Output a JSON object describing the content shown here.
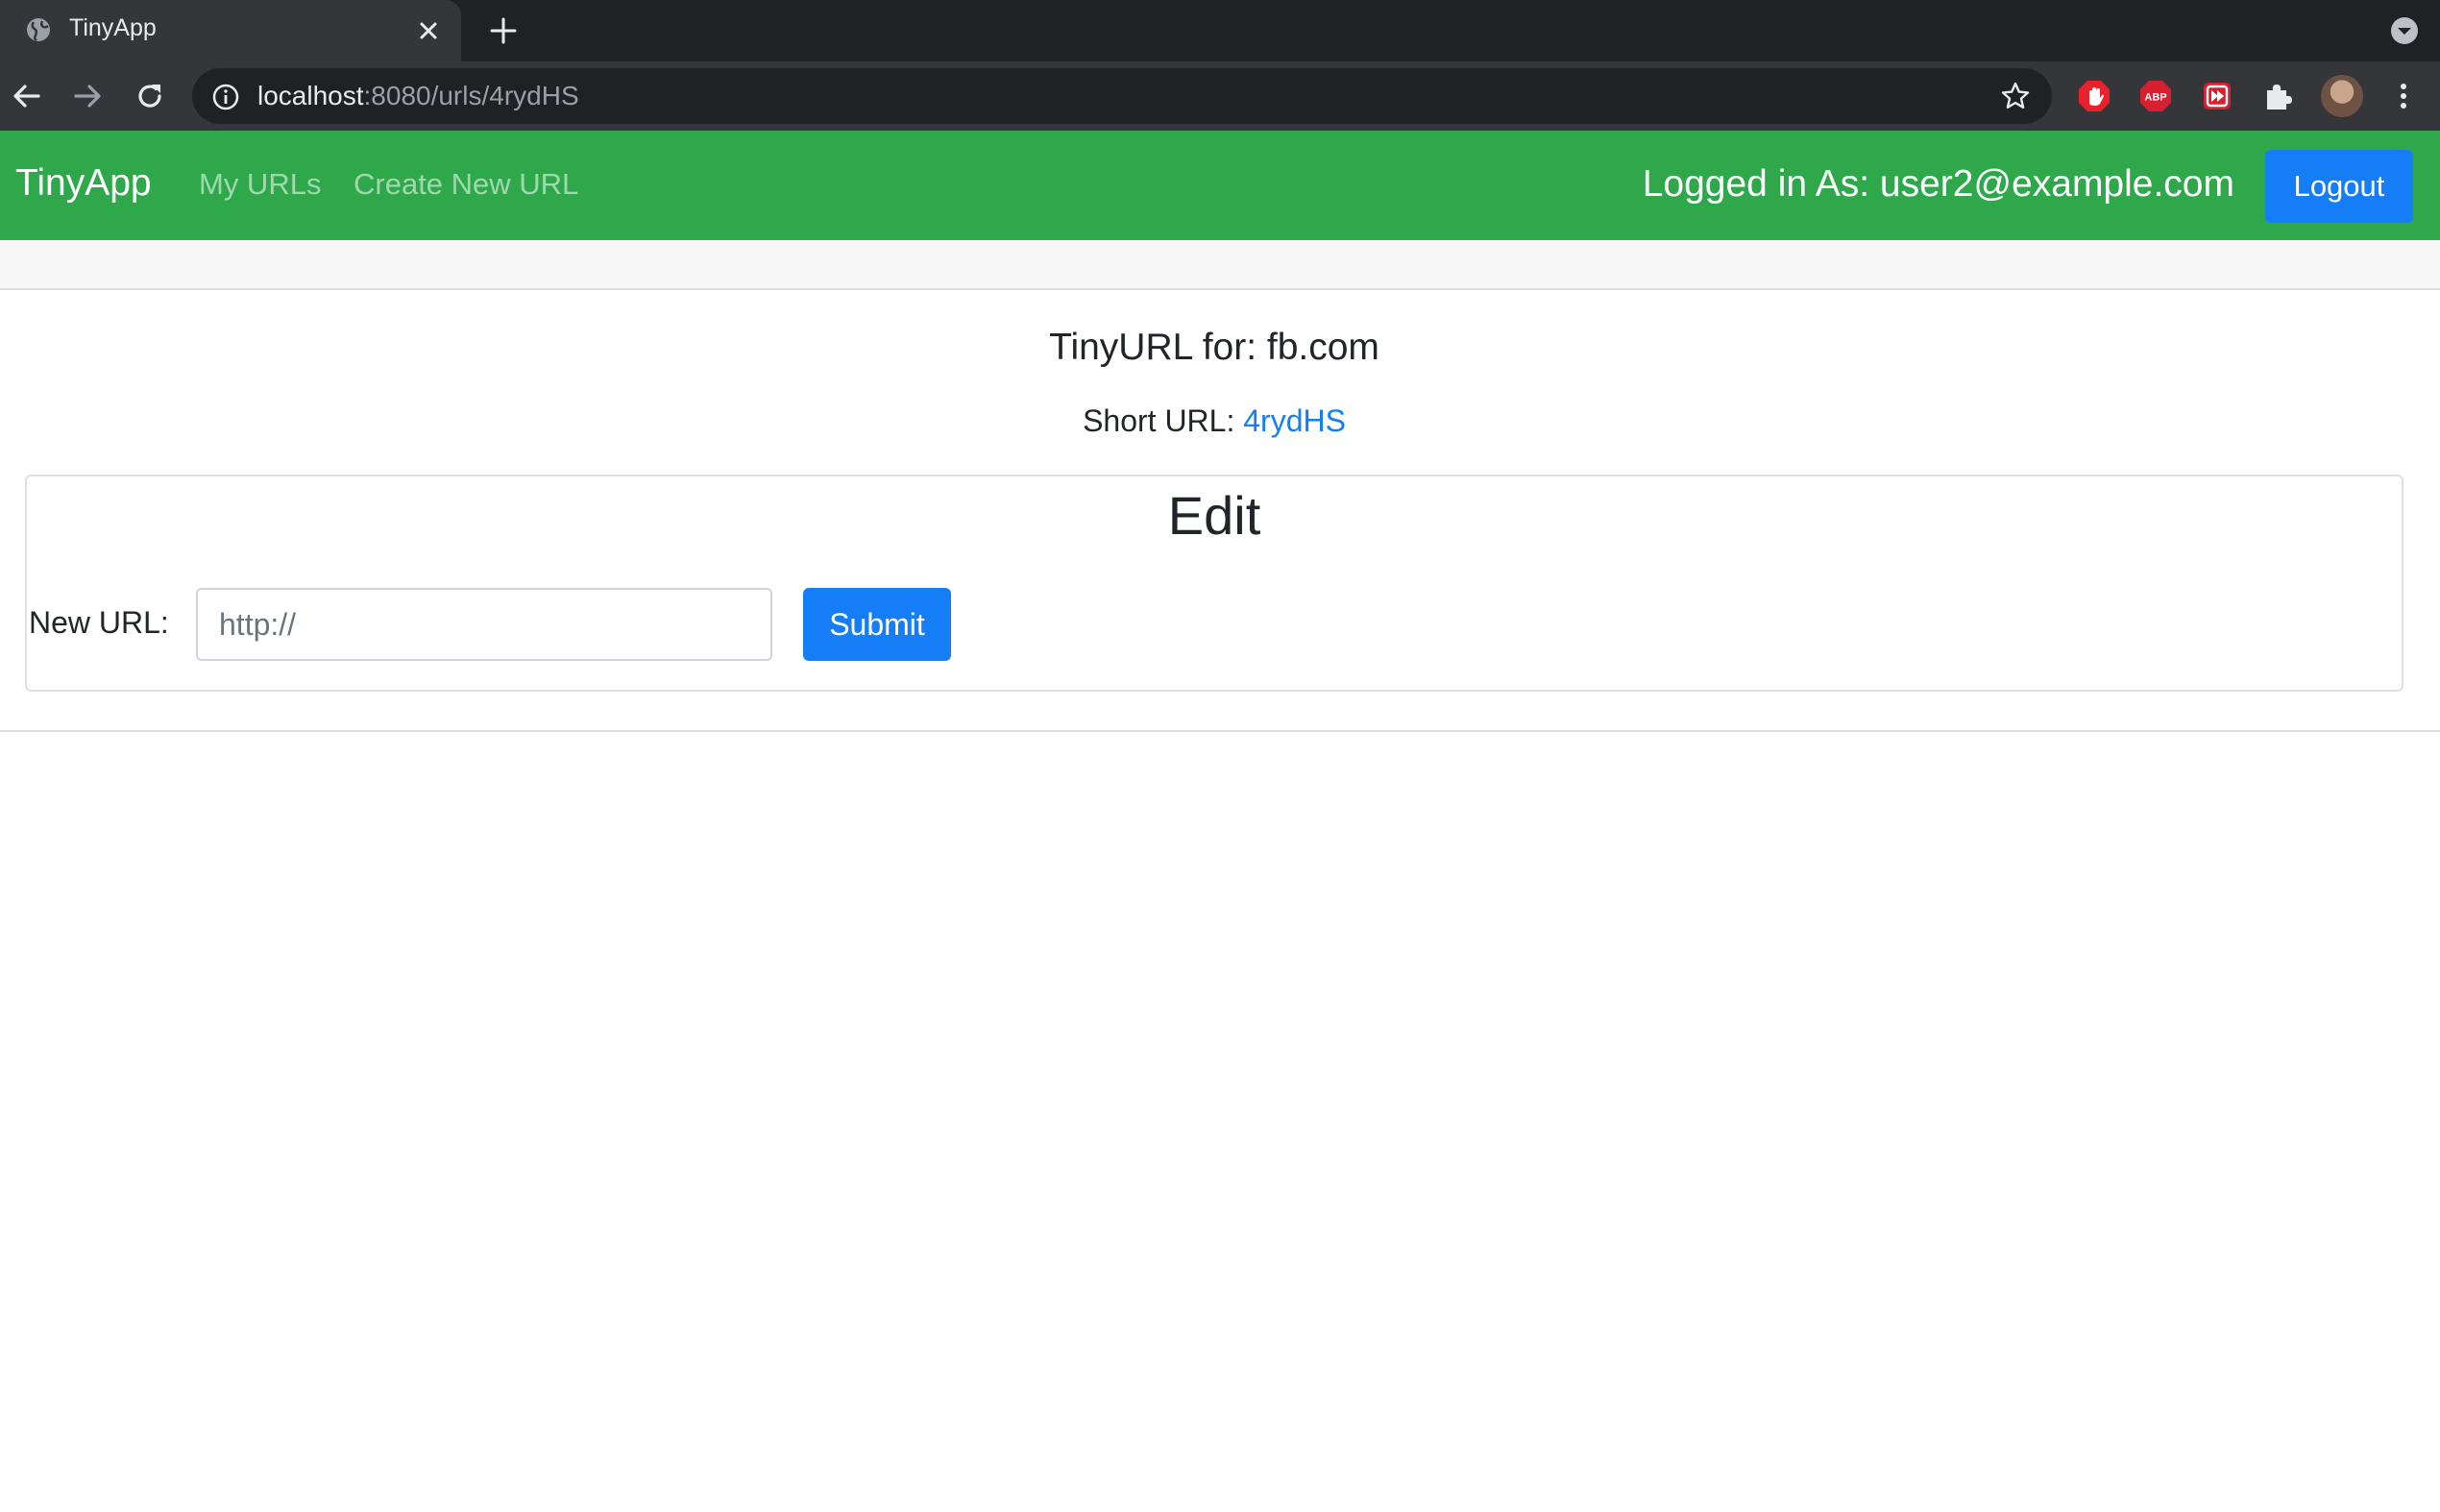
{
  "browser": {
    "tab_title": "TinyApp",
    "url_host": "localhost",
    "url_path": ":8080/urls/4rydHS",
    "icons": [
      "globe-icon",
      "close-icon",
      "plus-icon",
      "tab-search-icon",
      "back-arrow-icon",
      "forward-arrow-icon",
      "reload-icon",
      "info-icon",
      "star-icon",
      "adblock-hand-icon",
      "abp-icon",
      "media-extension-icon",
      "puzzle-extensions-icon",
      "profile-avatar",
      "kebab-menu-icon"
    ],
    "ext_abp_label": "ABP"
  },
  "navbar": {
    "brand": "TinyApp",
    "links": [
      "My URLs",
      "Create New URL"
    ],
    "logged_in": "Logged in As: user2@example.com",
    "logout_label": "Logout",
    "color": "#2ea84b"
  },
  "main": {
    "heading": "TinyURL for: fb.com",
    "short_url_label": "Short URL:",
    "short_url_value": "4rydHS",
    "edit_card": {
      "title": "Edit",
      "field_label": "New URL:",
      "input_placeholder": "http://",
      "input_value": "",
      "submit_label": "Submit"
    }
  },
  "colors": {
    "primary_button": "#157ef7",
    "link": "#157ef7"
  }
}
